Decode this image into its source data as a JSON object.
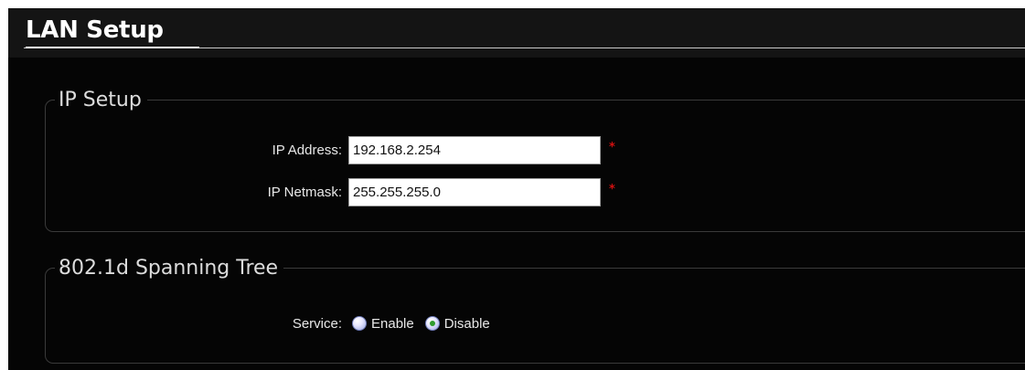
{
  "page": {
    "title": "LAN Setup"
  },
  "ip_setup": {
    "legend": "IP Setup",
    "ip_address": {
      "label": "IP Address:",
      "value": "192.168.2.254",
      "required_mark": "*"
    },
    "ip_netmask": {
      "label": "IP Netmask:",
      "value": "255.255.255.0",
      "required_mark": "*"
    }
  },
  "spanning_tree": {
    "legend": "802.1d Spanning Tree",
    "service": {
      "label": "Service:",
      "options": [
        {
          "label": "Enable",
          "checked": false
        },
        {
          "label": "Disable",
          "checked": true
        }
      ]
    }
  },
  "colors": {
    "background": "#050505",
    "required": "#d21010",
    "radio_selected": "#2e9b2e"
  }
}
